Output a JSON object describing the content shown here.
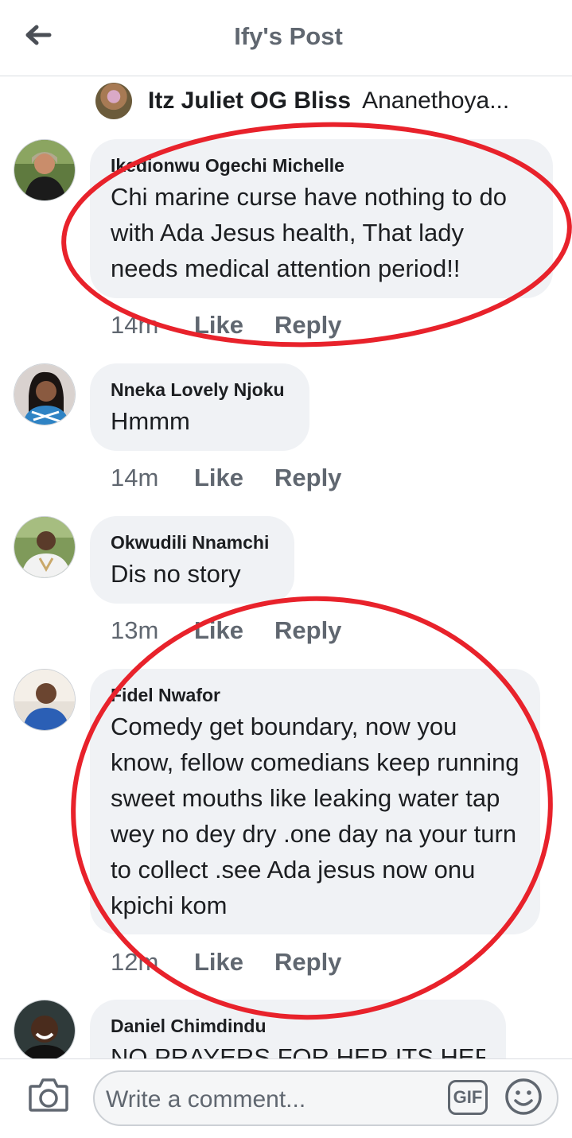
{
  "header": {
    "title": "Ify's Post",
    "back_icon": "arrow-left-icon"
  },
  "reply_preview": {
    "name": "Itz Juliet OG Bliss",
    "text": "Ananethoya..."
  },
  "comments": [
    {
      "name": "Ikedionwu Ogechi Michelle",
      "text": "Chi marine curse have nothing to do with Ada Jesus health, That lady needs medical attention period!!",
      "time": "14m",
      "like": "Like",
      "reply": "Reply"
    },
    {
      "name": "Nneka Lovely Njoku",
      "text": "Hmmm",
      "time": "14m",
      "like": "Like",
      "reply": "Reply"
    },
    {
      "name": "Okwudili Nnamchi",
      "text": "Dis no story",
      "time": "13m",
      "like": "Like",
      "reply": "Reply"
    },
    {
      "name": "Fidel Nwafor",
      "text": "Comedy get boundary, now you know, fellow comedians keep running sweet mouths like leaking water tap  wey no dey dry .one day na your turn to collect .see Ada jesus now onu kpichi kom",
      "time": "12m",
      "like": "Like",
      "reply": "Reply"
    },
    {
      "name": "Daniel Chimdindu",
      "text": "NO PRAYERS FOR HER ITS HER"
    }
  ],
  "composer": {
    "placeholder": "Write a comment...",
    "gif_label": "GIF",
    "camera_icon": "camera-icon",
    "emoji_icon": "smiley-icon"
  },
  "colors": {
    "bubble": "#f0f2f5",
    "secondary_text": "#606770",
    "annotation_red": "#e8222b"
  }
}
